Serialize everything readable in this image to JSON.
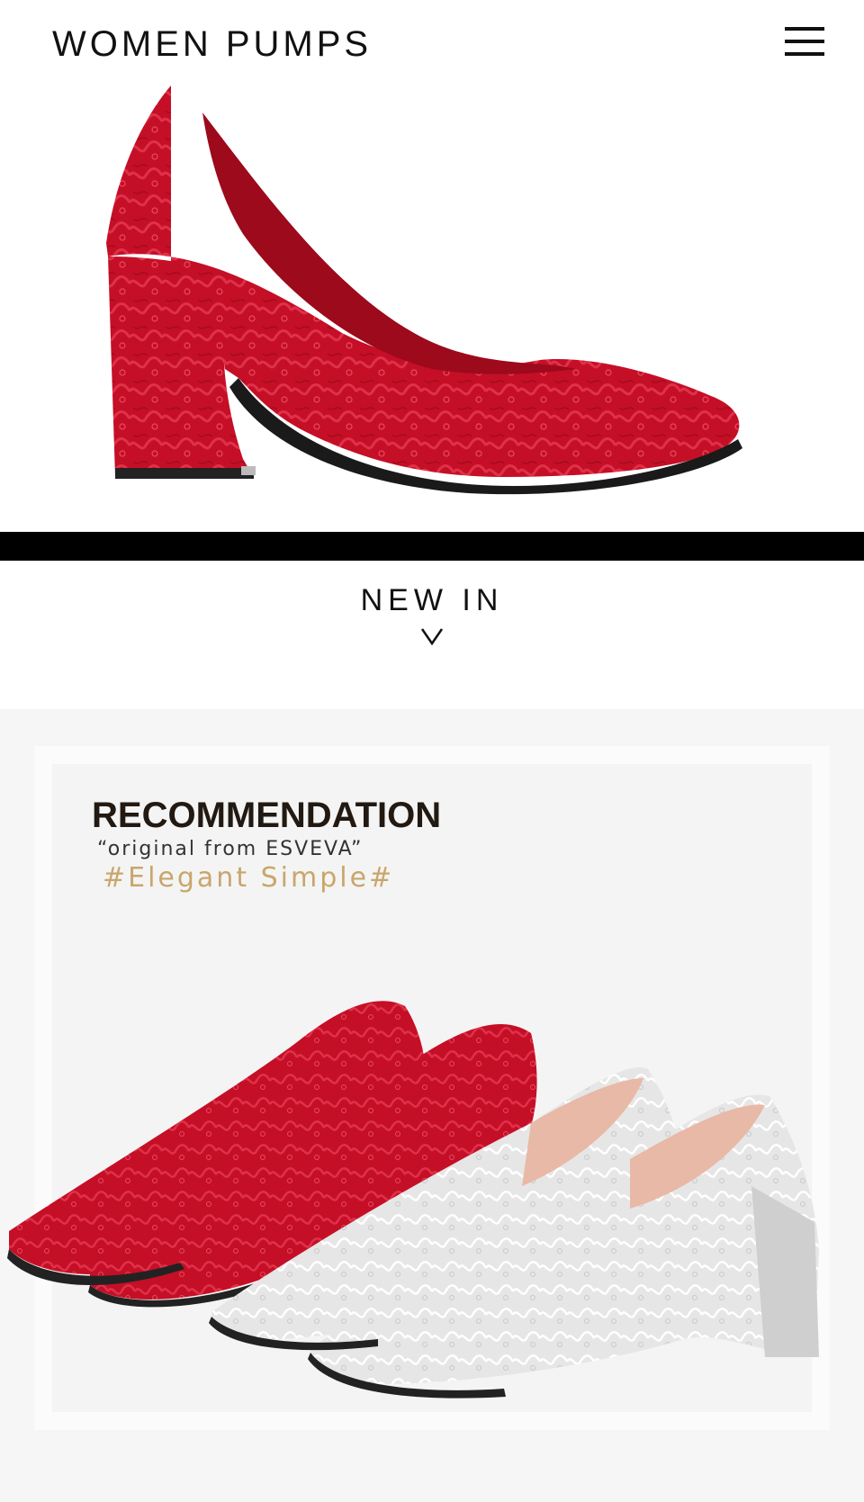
{
  "header": {
    "brand": "WOMEN PUMPS",
    "menu_icon": "hamburger-menu-icon"
  },
  "hero": {
    "image": "red-lace-pump-image",
    "color": "#c8102e"
  },
  "new_in": {
    "label": "NEW IN",
    "chevron_icon": "chevron-down-icon"
  },
  "recommendation": {
    "title": "RECOMMENDATION",
    "subtitle": "“original from ESVEVA”",
    "tag": "#Elegant Simple#",
    "tag_color": "#c9a66b",
    "image": "red-and-silver-pumps-image"
  }
}
